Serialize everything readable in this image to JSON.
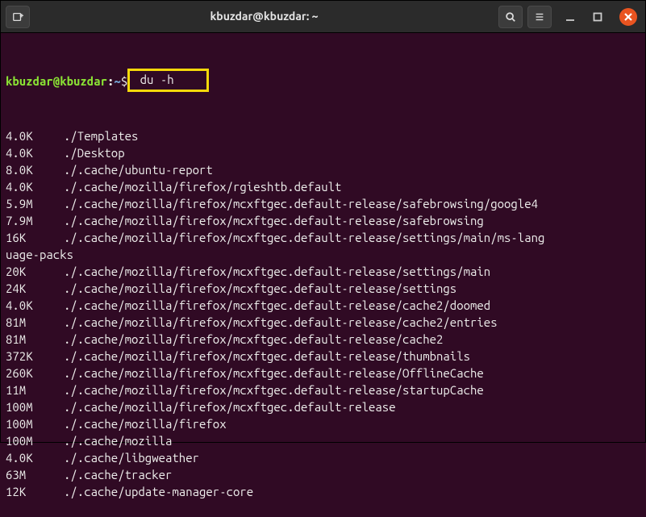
{
  "titlebar": {
    "title": "kbuzdar@kbuzdar: ~"
  },
  "prompt": {
    "user_host": "kbuzdar@kbuzdar",
    "colon": ":",
    "path": "~",
    "dollar": "$",
    "command": "du -h"
  },
  "output": [
    {
      "size": "4.0K",
      "path": "./Templates"
    },
    {
      "size": "4.0K",
      "path": "./Desktop"
    },
    {
      "size": "8.0K",
      "path": "./.cache/ubuntu-report"
    },
    {
      "size": "4.0K",
      "path": "./.cache/mozilla/firefox/rgieshtb.default"
    },
    {
      "size": "5.9M",
      "path": "./.cache/mozilla/firefox/mcxftgec.default-release/safebrowsing/google4"
    },
    {
      "size": "7.9M",
      "path": "./.cache/mozilla/firefox/mcxftgec.default-release/safebrowsing"
    },
    {
      "size": "16K",
      "path": "./.cache/mozilla/firefox/mcxftgec.default-release/settings/main/ms-language-packs",
      "wrap": true
    },
    {
      "size": "20K",
      "path": "./.cache/mozilla/firefox/mcxftgec.default-release/settings/main"
    },
    {
      "size": "24K",
      "path": "./.cache/mozilla/firefox/mcxftgec.default-release/settings"
    },
    {
      "size": "4.0K",
      "path": "./.cache/mozilla/firefox/mcxftgec.default-release/cache2/doomed"
    },
    {
      "size": "81M",
      "path": "./.cache/mozilla/firefox/mcxftgec.default-release/cache2/entries"
    },
    {
      "size": "81M",
      "path": "./.cache/mozilla/firefox/mcxftgec.default-release/cache2"
    },
    {
      "size": "372K",
      "path": "./.cache/mozilla/firefox/mcxftgec.default-release/thumbnails"
    },
    {
      "size": "260K",
      "path": "./.cache/mozilla/firefox/mcxftgec.default-release/OfflineCache"
    },
    {
      "size": "11M",
      "path": "./.cache/mozilla/firefox/mcxftgec.default-release/startupCache"
    },
    {
      "size": "100M",
      "path": "./.cache/mozilla/firefox/mcxftgec.default-release"
    },
    {
      "size": "100M",
      "path": "./.cache/mozilla/firefox"
    },
    {
      "size": "100M",
      "path": "./.cache/mozilla"
    },
    {
      "size": "4.0K",
      "path": "./.cache/libgweather"
    },
    {
      "size": "63M",
      "path": "./.cache/tracker"
    },
    {
      "size": "12K",
      "path": "./.cache/update-manager-core"
    }
  ]
}
